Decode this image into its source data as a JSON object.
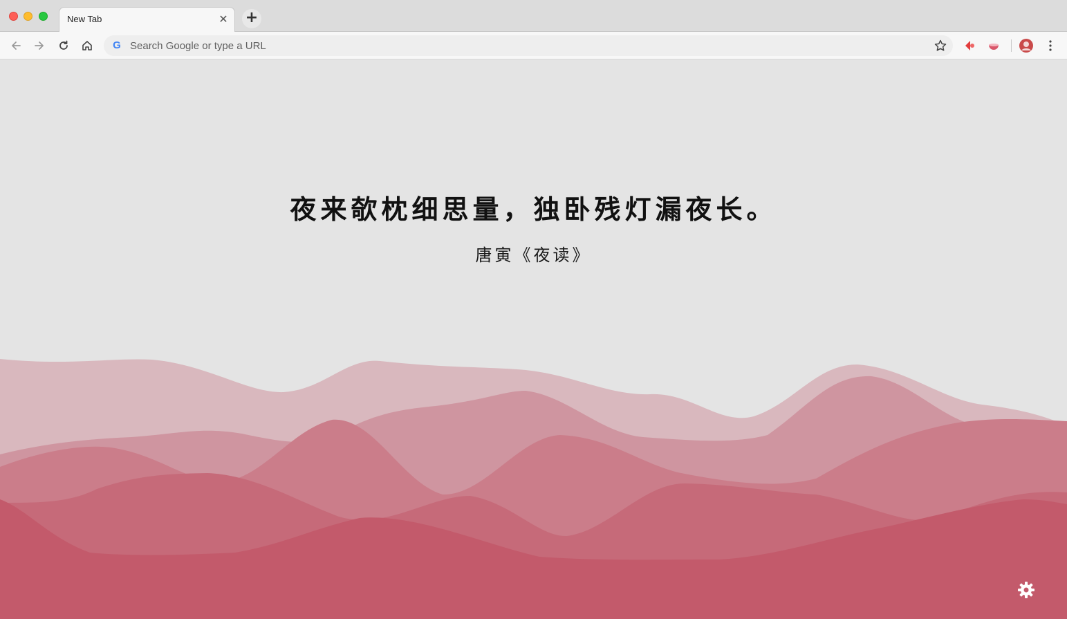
{
  "browser": {
    "tab": {
      "title": "New Tab",
      "close_glyph": "✕"
    },
    "new_tab_glyph": "+",
    "omnibox": {
      "placeholder": "Search Google or type a URL",
      "engine_glyph": "G"
    },
    "icons": {
      "back": "back-arrow-icon",
      "forward": "forward-arrow-icon",
      "reload": "reload-icon",
      "home": "home-icon",
      "bookmark": "star-icon",
      "extension_1": "red-extension-icon",
      "extension_2": "pink-bowl-extension-icon",
      "profile": "profile-avatar-icon",
      "menu": "kebab-menu-icon"
    }
  },
  "page": {
    "poem": "夜来欹枕细思量，独卧残灯漏夜长。",
    "source": "唐寅《夜读》",
    "settings_icon": "gear-icon",
    "wave_colors": [
      "#d9b8be",
      "#cf95a0",
      "#cb7d8a",
      "#c66a79",
      "#c35a6b"
    ]
  }
}
